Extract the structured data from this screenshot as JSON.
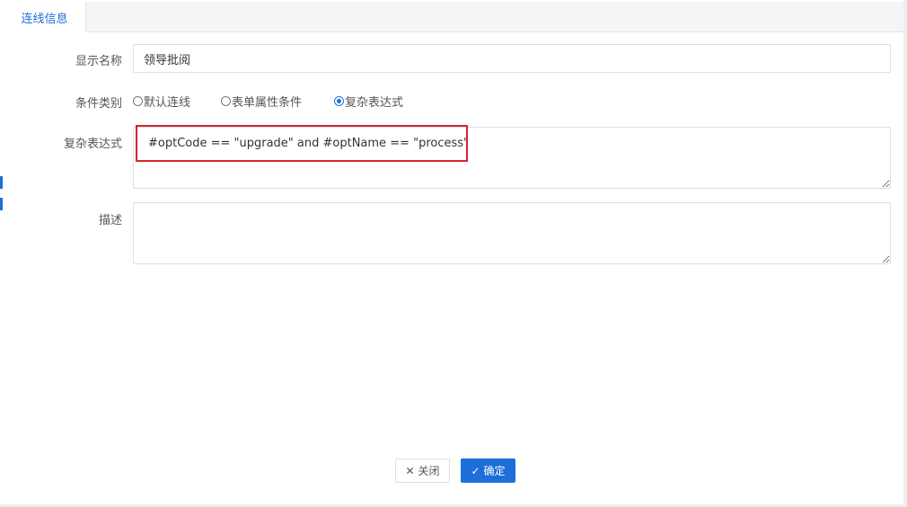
{
  "tab": {
    "label": "连线信息"
  },
  "form": {
    "display_name": {
      "label": "显示名称",
      "value": "领导批阅"
    },
    "condition_type": {
      "label": "条件类别",
      "options": [
        "默认连线",
        "表单属性条件",
        "复杂表达式"
      ],
      "selected": "复杂表达式"
    },
    "expression": {
      "label": "复杂表达式",
      "value": "#optCode == \"upgrade\" and #optName == \"process\""
    },
    "description": {
      "label": "描述",
      "value": ""
    }
  },
  "buttons": {
    "close_label": "关闭",
    "ok_label": "确定"
  },
  "icons": {
    "close": "x-icon",
    "ok": "check-icon"
  },
  "colors": {
    "accent": "#1e6fd9",
    "highlight": "#d9232d"
  }
}
